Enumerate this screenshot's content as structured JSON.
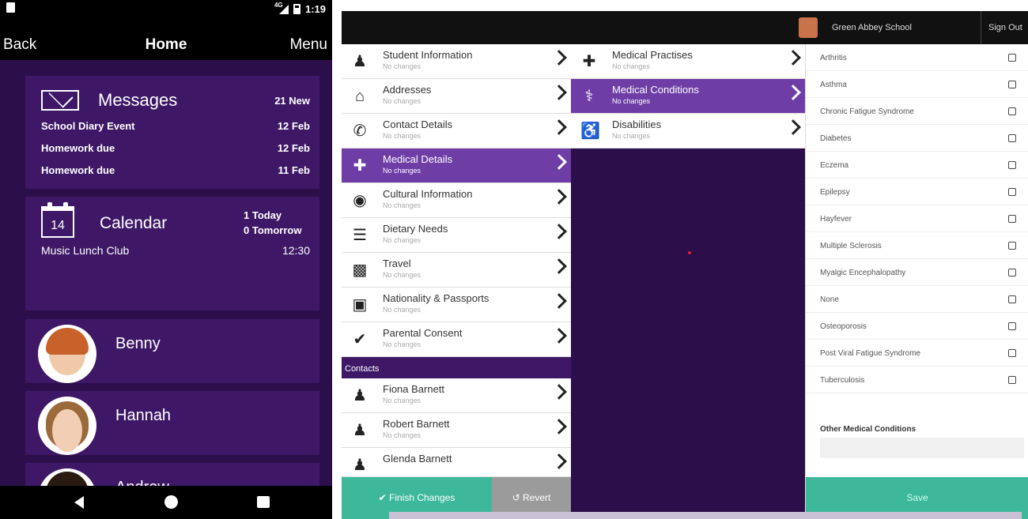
{
  "phone": {
    "status": {
      "network": "4G",
      "time": "1:19"
    },
    "nav": {
      "back": "Back",
      "title": "Home",
      "menu": "Menu"
    },
    "messages": {
      "title": "Messages",
      "count": "21 New",
      "items": [
        {
          "label": "School Diary Event",
          "date": "12 Feb"
        },
        {
          "label": "Homework due",
          "date": "12 Feb"
        },
        {
          "label": "Homework due",
          "date": "11 Feb"
        }
      ]
    },
    "calendar": {
      "icon_day": "14",
      "title": "Calendar",
      "today": "1 Today",
      "tomorrow": "0 Tomorrow",
      "event": {
        "label": "Music Lunch Club",
        "time": "12:30"
      }
    },
    "people": [
      {
        "name": "Benny"
      },
      {
        "name": "Hannah"
      },
      {
        "name": "Andrew"
      }
    ]
  },
  "tablet": {
    "school_name": "Green Abbey School",
    "sign_out": "Sign Out",
    "student_menu": [
      {
        "label": "Student Information",
        "sub": "No changes",
        "icon": "person-icon"
      },
      {
        "label": "Addresses",
        "sub": "No changes",
        "icon": "home-icon"
      },
      {
        "label": "Contact Details",
        "sub": "No changes",
        "icon": "phone-icon"
      },
      {
        "label": "Medical Details",
        "sub": "No changes",
        "icon": "medical-kit-icon"
      },
      {
        "label": "Cultural Information",
        "sub": "No changes",
        "icon": "globe-icon"
      },
      {
        "label": "Dietary Needs",
        "sub": "No changes",
        "icon": "fork-knife-icon"
      },
      {
        "label": "Travel",
        "sub": "No changes",
        "icon": "car-icon"
      },
      {
        "label": "Nationality & Passports",
        "sub": "No changes",
        "icon": "passport-icon"
      },
      {
        "label": "Parental Consent",
        "sub": "No changes",
        "icon": "check-icon"
      }
    ],
    "contacts_header": "Contacts",
    "contacts": [
      {
        "label": "Fiona Barnett",
        "sub": "No changes"
      },
      {
        "label": "Robert Barnett",
        "sub": "No changes"
      },
      {
        "label": "Glenda Barnett",
        "sub": ""
      }
    ],
    "finish_label": "✔ Finish Changes",
    "revert_label": "↺ Revert",
    "medical_menu": [
      {
        "label": "Medical Practises",
        "sub": "No changes",
        "icon": "plus-cross-icon"
      },
      {
        "label": "Medical Conditions",
        "sub": "No changes",
        "icon": "stethoscope-icon"
      },
      {
        "label": "Disabilities",
        "sub": "No changes",
        "icon": "wheelchair-icon"
      }
    ],
    "conditions": [
      "Arthritis",
      "Asthma",
      "Chronic Fatigue Syndrome",
      "Diabetes",
      "Eczema",
      "Epilepsy",
      "Hayfever",
      "Multiple Sclerosis",
      "Myalgic Encephalopathy",
      "None",
      "Osteoporosis",
      "Post Viral Fatigue Syndrome",
      "Tuberculosis"
    ],
    "other_label": "Other Medical Conditions",
    "save_label": "Save"
  },
  "colors": {
    "purple_dark": "#2c0f4a",
    "purple_card": "#3e1866",
    "purple_active": "#6e3ea6",
    "teal": "#3db89a"
  }
}
